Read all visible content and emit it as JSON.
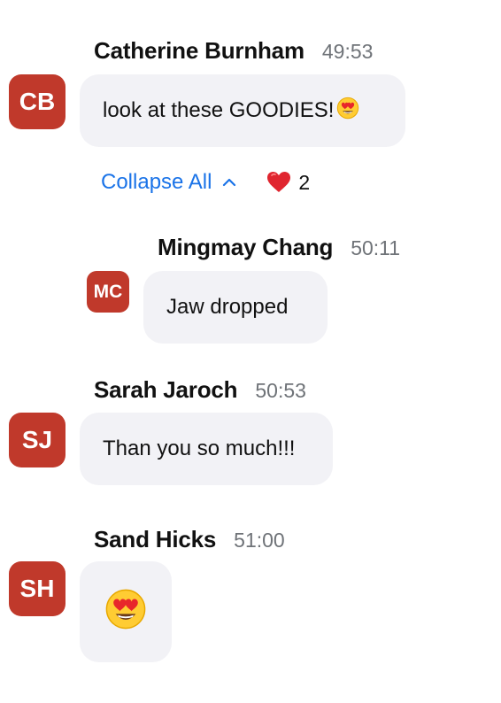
{
  "colors": {
    "avatar_bg": "#c0392b",
    "bubble_bg": "#f2f2f6",
    "link": "#1a73e8",
    "timestamp": "#6f7378",
    "heart": "#e0252f"
  },
  "messages": [
    {
      "sender": "Catherine Burnham",
      "time": "49:53",
      "initials": "CB",
      "text": "look at these GOODIES!",
      "emoji": "heart-eyes-emoji"
    },
    {
      "sender": "Mingmay Chang",
      "time": "50:11",
      "initials": "MC",
      "text": "Jaw dropped"
    },
    {
      "sender": "Sarah Jaroch",
      "time": "50:53",
      "initials": "SJ",
      "text": "Than you so much!!!"
    },
    {
      "sender": "Sand Hicks",
      "time": "51:00",
      "initials": "SH",
      "emoji": "heart-eyes-emoji"
    }
  ],
  "thread": {
    "collapse_label": "Collapse All",
    "collapse_icon": "chevron-up-icon",
    "reaction_icon": "red-heart-icon",
    "reaction_count": "2"
  }
}
